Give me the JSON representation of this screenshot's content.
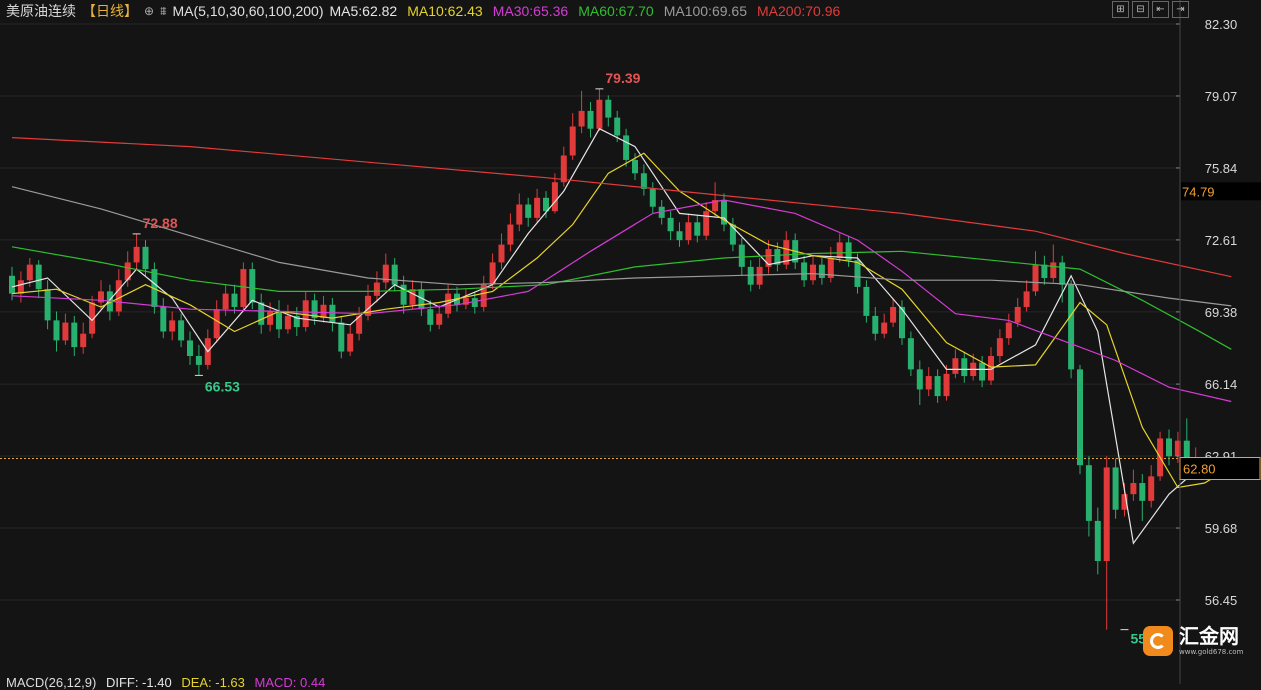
{
  "header": {
    "symbol": "美原油连续",
    "period": "【日线】",
    "settings_icon": "crosshair-circle-icon",
    "ma_icon": "ma-indicator-icon",
    "ma_params": "MA(5,10,30,60,100,200)",
    "ma_values": [
      {
        "label": "MA5:62.82",
        "color": "#e6e6e6"
      },
      {
        "label": "MA10:62.43",
        "color": "#e6d32a"
      },
      {
        "label": "MA30:65.36",
        "color": "#d63bd6"
      },
      {
        "label": "MA60:67.70",
        "color": "#2fbf2f"
      },
      {
        "label": "MA100:69.65",
        "color": "#9a9a9a"
      },
      {
        "label": "MA200:70.96",
        "color": "#e23b3b"
      }
    ]
  },
  "toolbar": {
    "buttons": [
      "zoom-in-icon",
      "zoom-out-icon",
      "pan-left-icon",
      "pan-right-icon"
    ],
    "glyphs": [
      "⊞",
      "⊟",
      "⇤",
      "⇥"
    ]
  },
  "axis": {
    "ticks": [
      "82.30",
      "79.07",
      "75.84",
      "72.61",
      "69.38",
      "66.14",
      "62.91",
      "59.68",
      "56.45"
    ]
  },
  "prices": {
    "reference": "74.79",
    "last": "62.80",
    "last_value": 62.8
  },
  "annotations": {
    "high": "79.39",
    "local_high": "72.88",
    "local_low": "66.53",
    "low": "55.12"
  },
  "brand": {
    "name": "汇金网",
    "url": "www.gold678.com"
  },
  "macd": {
    "params": "MACD(26,12,9)",
    "diff": "DIFF: -1.40",
    "dea": "DEA: -1.63",
    "macd": "MACD: 0.44"
  },
  "colors": {
    "up": "#e03a3a",
    "down": "#27b06e",
    "ma5": "#e6e6e6",
    "ma10": "#e6d32a",
    "ma30": "#d63bd6",
    "ma60": "#2fbf2f",
    "ma100": "#9a9a9a",
    "ma200": "#e23b3b",
    "axis_accent": "#f0a030"
  },
  "chart_data": {
    "type": "candlestick",
    "ylim": [
      55.0,
      82.3
    ],
    "candles": [
      [
        71.0,
        70.2,
        71.4,
        69.9
      ],
      [
        70.2,
        70.8,
        71.2,
        69.8
      ],
      [
        70.8,
        71.5,
        71.8,
        70.5
      ],
      [
        71.5,
        70.4,
        71.7,
        70.0
      ],
      [
        70.4,
        69.0,
        70.8,
        68.6
      ],
      [
        69.0,
        68.1,
        69.4,
        67.6
      ],
      [
        68.1,
        68.9,
        69.3,
        67.9
      ],
      [
        68.9,
        67.8,
        69.2,
        67.4
      ],
      [
        67.8,
        68.4,
        68.9,
        67.5
      ],
      [
        68.4,
        69.8,
        70.1,
        68.2
      ],
      [
        69.8,
        70.3,
        70.8,
        69.5
      ],
      [
        70.3,
        69.4,
        70.6,
        69.0
      ],
      [
        69.4,
        70.8,
        71.3,
        69.2
      ],
      [
        70.8,
        71.6,
        72.1,
        70.5
      ],
      [
        71.6,
        72.3,
        72.88,
        71.3
      ],
      [
        72.3,
        71.3,
        72.6,
        71.0
      ],
      [
        71.3,
        69.6,
        71.6,
        69.3
      ],
      [
        69.6,
        68.5,
        70.0,
        68.2
      ],
      [
        68.5,
        69.0,
        69.4,
        68.1
      ],
      [
        69.0,
        68.1,
        69.3,
        67.8
      ],
      [
        68.1,
        67.4,
        68.5,
        67.0
      ],
      [
        67.4,
        67.0,
        67.9,
        66.53
      ],
      [
        67.0,
        68.2,
        68.6,
        66.8
      ],
      [
        68.2,
        69.5,
        69.9,
        68.0
      ],
      [
        69.5,
        70.2,
        70.6,
        69.2
      ],
      [
        70.2,
        69.6,
        70.6,
        69.3
      ],
      [
        69.6,
        71.3,
        71.6,
        69.4
      ],
      [
        71.3,
        69.8,
        71.6,
        69.5
      ],
      [
        69.8,
        68.8,
        70.2,
        68.4
      ],
      [
        68.8,
        69.4,
        69.8,
        68.5
      ],
      [
        69.4,
        68.6,
        69.9,
        68.2
      ],
      [
        68.6,
        69.2,
        69.7,
        68.4
      ],
      [
        69.2,
        68.7,
        69.6,
        68.3
      ],
      [
        68.7,
        69.9,
        70.3,
        68.5
      ],
      [
        69.9,
        69.1,
        70.2,
        68.8
      ],
      [
        69.1,
        69.7,
        70.1,
        68.9
      ],
      [
        69.7,
        68.9,
        70.0,
        68.5
      ],
      [
        68.9,
        67.6,
        69.2,
        67.3
      ],
      [
        67.6,
        68.4,
        68.8,
        67.4
      ],
      [
        68.4,
        69.2,
        69.6,
        68.1
      ],
      [
        69.2,
        70.1,
        70.6,
        69.0
      ],
      [
        70.1,
        70.7,
        71.2,
        69.8
      ],
      [
        70.7,
        71.5,
        72.0,
        70.4
      ],
      [
        71.5,
        70.6,
        71.8,
        70.3
      ],
      [
        70.6,
        69.7,
        71.0,
        69.3
      ],
      [
        69.7,
        70.4,
        70.8,
        69.5
      ],
      [
        70.4,
        69.5,
        70.7,
        69.2
      ],
      [
        69.5,
        68.8,
        69.9,
        68.5
      ],
      [
        68.8,
        69.3,
        69.7,
        68.6
      ],
      [
        69.3,
        70.2,
        70.6,
        69.1
      ],
      [
        70.2,
        69.7,
        70.5,
        69.4
      ],
      [
        69.7,
        70.0,
        70.4,
        69.5
      ],
      [
        70.0,
        69.6,
        70.3,
        69.3
      ],
      [
        69.6,
        70.6,
        71.0,
        69.4
      ],
      [
        70.6,
        71.6,
        72.0,
        70.4
      ],
      [
        71.6,
        72.4,
        72.9,
        71.3
      ],
      [
        72.4,
        73.3,
        73.8,
        72.1
      ],
      [
        73.3,
        74.2,
        74.7,
        73.0
      ],
      [
        74.2,
        73.6,
        74.5,
        73.2
      ],
      [
        73.6,
        74.5,
        74.9,
        73.4
      ],
      [
        74.5,
        73.9,
        74.8,
        73.6
      ],
      [
        73.9,
        75.2,
        75.6,
        73.8
      ],
      [
        75.2,
        76.4,
        76.8,
        75.0
      ],
      [
        76.4,
        77.7,
        78.3,
        76.2
      ],
      [
        77.7,
        78.4,
        79.3,
        77.4
      ],
      [
        78.4,
        77.6,
        78.8,
        77.2
      ],
      [
        77.6,
        78.9,
        79.39,
        77.5
      ],
      [
        78.9,
        78.1,
        79.1,
        77.7
      ],
      [
        78.1,
        77.3,
        78.4,
        77.0
      ],
      [
        77.3,
        76.2,
        77.6,
        75.9
      ],
      [
        76.2,
        75.6,
        76.5,
        75.3
      ],
      [
        75.6,
        74.9,
        76.0,
        74.6
      ],
      [
        74.9,
        74.1,
        75.2,
        73.8
      ],
      [
        74.1,
        73.6,
        74.4,
        73.3
      ],
      [
        73.6,
        73.0,
        73.9,
        72.6
      ],
      [
        73.0,
        72.6,
        73.4,
        72.3
      ],
      [
        72.6,
        73.4,
        73.8,
        72.4
      ],
      [
        73.4,
        72.8,
        73.7,
        72.5
      ],
      [
        72.8,
        73.9,
        74.3,
        72.6
      ],
      [
        73.9,
        74.4,
        75.2,
        73.6
      ],
      [
        74.4,
        73.3,
        74.7,
        73.0
      ],
      [
        73.3,
        72.4,
        73.6,
        72.1
      ],
      [
        72.4,
        71.4,
        72.7,
        71.0
      ],
      [
        71.4,
        70.6,
        71.7,
        70.3
      ],
      [
        70.6,
        71.4,
        71.8,
        70.4
      ],
      [
        71.4,
        72.2,
        72.6,
        71.1
      ],
      [
        72.2,
        71.5,
        72.5,
        71.2
      ],
      [
        71.5,
        72.6,
        73.0,
        71.3
      ],
      [
        72.6,
        71.6,
        72.9,
        71.3
      ],
      [
        71.6,
        70.8,
        71.9,
        70.5
      ],
      [
        70.8,
        71.5,
        71.9,
        70.6
      ],
      [
        71.5,
        70.9,
        71.8,
        70.6
      ],
      [
        70.9,
        71.8,
        72.3,
        70.7
      ],
      [
        71.8,
        72.5,
        72.9,
        71.6
      ],
      [
        72.5,
        71.7,
        72.8,
        71.4
      ],
      [
        71.7,
        70.5,
        72.0,
        70.2
      ],
      [
        70.5,
        69.2,
        70.8,
        68.9
      ],
      [
        69.2,
        68.4,
        69.6,
        68.1
      ],
      [
        68.4,
        68.9,
        69.3,
        68.2
      ],
      [
        68.9,
        69.6,
        70.0,
        68.7
      ],
      [
        69.6,
        68.2,
        69.9,
        67.9
      ],
      [
        68.2,
        66.8,
        68.5,
        66.5
      ],
      [
        66.8,
        65.9,
        67.2,
        65.2
      ],
      [
        65.9,
        66.5,
        66.9,
        65.6
      ],
      [
        66.5,
        65.6,
        66.8,
        65.3
      ],
      [
        65.6,
        66.6,
        67.0,
        65.4
      ],
      [
        66.6,
        67.3,
        67.7,
        66.4
      ],
      [
        67.3,
        66.5,
        67.6,
        66.2
      ],
      [
        66.5,
        67.1,
        67.5,
        66.3
      ],
      [
        67.1,
        66.3,
        67.4,
        66.0
      ],
      [
        66.3,
        67.4,
        67.8,
        66.1
      ],
      [
        67.4,
        68.2,
        68.6,
        67.1
      ],
      [
        68.2,
        68.9,
        69.3,
        67.9
      ],
      [
        68.9,
        69.6,
        70.0,
        68.7
      ],
      [
        69.6,
        70.3,
        70.8,
        69.4
      ],
      [
        70.3,
        71.5,
        72.1,
        70.1
      ],
      [
        71.5,
        70.9,
        71.9,
        70.6
      ],
      [
        70.9,
        71.6,
        72.4,
        70.7
      ],
      [
        71.6,
        70.6,
        71.9,
        69.8
      ],
      [
        70.6,
        66.8,
        70.8,
        66.4
      ],
      [
        66.8,
        62.5,
        67.0,
        62.1
      ],
      [
        62.5,
        60.0,
        62.9,
        59.3
      ],
      [
        60.0,
        58.2,
        60.6,
        57.6
      ],
      [
        58.2,
        62.4,
        62.9,
        55.12
      ],
      [
        62.4,
        60.5,
        62.8,
        60.1
      ],
      [
        60.5,
        61.2,
        61.7,
        60.2
      ],
      [
        61.2,
        61.7,
        62.3,
        60.9
      ],
      [
        61.7,
        60.9,
        62.1,
        60.0
      ],
      [
        60.9,
        62.0,
        62.5,
        60.6
      ],
      [
        62.0,
        63.7,
        64.0,
        61.8
      ],
      [
        63.7,
        62.9,
        64.1,
        62.5
      ],
      [
        62.9,
        63.6,
        64.0,
        62.6
      ],
      [
        63.6,
        62.7,
        64.6,
        62.3
      ],
      [
        62.7,
        62.8,
        63.3,
        62.4
      ]
    ],
    "ma": {
      "ma5": {
        "color": "#e6e6e6",
        "points": [
          [
            0,
            70.5
          ],
          [
            4,
            70.9
          ],
          [
            9,
            69.0
          ],
          [
            14,
            71.3
          ],
          [
            18,
            70.0
          ],
          [
            22,
            67.6
          ],
          [
            27,
            69.9
          ],
          [
            32,
            69.1
          ],
          [
            38,
            68.8
          ],
          [
            43,
            70.6
          ],
          [
            48,
            69.6
          ],
          [
            54,
            70.6
          ],
          [
            58,
            72.9
          ],
          [
            62,
            74.8
          ],
          [
            66,
            77.6
          ],
          [
            70,
            76.8
          ],
          [
            75,
            73.8
          ],
          [
            80,
            73.6
          ],
          [
            85,
            71.5
          ],
          [
            90,
            71.9
          ],
          [
            95,
            71.8
          ],
          [
            100,
            69.5
          ],
          [
            105,
            66.8
          ],
          [
            110,
            66.8
          ],
          [
            115,
            67.9
          ],
          [
            119,
            71.0
          ],
          [
            122,
            68.5
          ],
          [
            126,
            59.0
          ],
          [
            130,
            61.2
          ],
          [
            134,
            62.6
          ],
          [
            137,
            62.82
          ]
        ]
      },
      "ma10": {
        "color": "#e6d32a",
        "points": [
          [
            0,
            70.2
          ],
          [
            5,
            70.4
          ],
          [
            10,
            69.6
          ],
          [
            15,
            70.6
          ],
          [
            20,
            69.7
          ],
          [
            25,
            68.5
          ],
          [
            30,
            69.4
          ],
          [
            36,
            69.1
          ],
          [
            42,
            69.5
          ],
          [
            48,
            69.8
          ],
          [
            54,
            70.3
          ],
          [
            59,
            71.8
          ],
          [
            63,
            73.3
          ],
          [
            67,
            75.6
          ],
          [
            71,
            76.5
          ],
          [
            75,
            74.8
          ],
          [
            80,
            73.5
          ],
          [
            85,
            72.4
          ],
          [
            90,
            71.9
          ],
          [
            95,
            71.6
          ],
          [
            100,
            70.4
          ],
          [
            105,
            68.0
          ],
          [
            110,
            66.9
          ],
          [
            115,
            67.0
          ],
          [
            120,
            69.8
          ],
          [
            123,
            68.8
          ],
          [
            127,
            64.2
          ],
          [
            131,
            61.5
          ],
          [
            134,
            61.7
          ],
          [
            137,
            62.43
          ]
        ]
      },
      "ma30": {
        "color": "#d63bd6",
        "points": [
          [
            0,
            70.1
          ],
          [
            10,
            69.9
          ],
          [
            20,
            69.5
          ],
          [
            30,
            69.4
          ],
          [
            40,
            69.3
          ],
          [
            50,
            69.7
          ],
          [
            58,
            70.3
          ],
          [
            65,
            72.1
          ],
          [
            72,
            73.8
          ],
          [
            80,
            74.4
          ],
          [
            88,
            73.8
          ],
          [
            95,
            72.6
          ],
          [
            100,
            71.2
          ],
          [
            106,
            69.3
          ],
          [
            112,
            69.0
          ],
          [
            118,
            68.1
          ],
          [
            124,
            67.2
          ],
          [
            130,
            66.0
          ],
          [
            137,
            65.36
          ]
        ]
      },
      "ma60": {
        "color": "#2fbf2f",
        "points": [
          [
            0,
            72.3
          ],
          [
            10,
            71.6
          ],
          [
            20,
            70.8
          ],
          [
            30,
            70.3
          ],
          [
            40,
            70.3
          ],
          [
            50,
            70.4
          ],
          [
            60,
            70.6
          ],
          [
            70,
            71.4
          ],
          [
            80,
            71.8
          ],
          [
            90,
            72.0
          ],
          [
            100,
            72.1
          ],
          [
            110,
            71.7
          ],
          [
            120,
            71.3
          ],
          [
            127,
            69.9
          ],
          [
            133,
            68.6
          ],
          [
            137,
            67.7
          ]
        ]
      },
      "ma100": {
        "color": "#9a9a9a",
        "points": [
          [
            0,
            75.0
          ],
          [
            10,
            74.0
          ],
          [
            20,
            72.8
          ],
          [
            30,
            71.6
          ],
          [
            40,
            70.9
          ],
          [
            50,
            70.6
          ],
          [
            60,
            70.7
          ],
          [
            70,
            70.9
          ],
          [
            80,
            71.0
          ],
          [
            90,
            71.1
          ],
          [
            100,
            70.8
          ],
          [
            110,
            70.8
          ],
          [
            120,
            70.6
          ],
          [
            130,
            70.0
          ],
          [
            137,
            69.65
          ]
        ]
      },
      "ma200": {
        "color": "#e23b3b",
        "points": [
          [
            0,
            77.2
          ],
          [
            20,
            76.8
          ],
          [
            40,
            76.1
          ],
          [
            60,
            75.4
          ],
          [
            80,
            74.6
          ],
          [
            100,
            73.8
          ],
          [
            115,
            73.0
          ],
          [
            125,
            72.0
          ],
          [
            137,
            70.96
          ]
        ]
      }
    }
  }
}
